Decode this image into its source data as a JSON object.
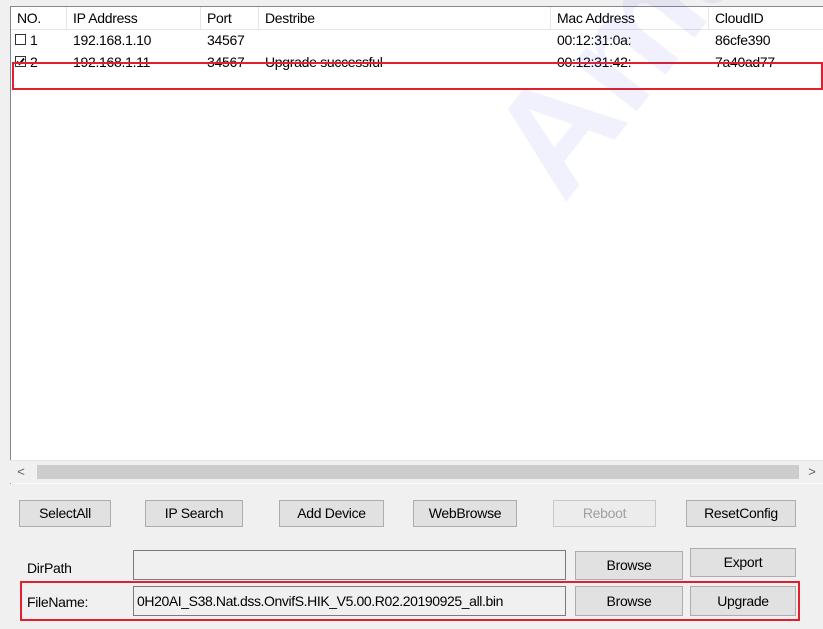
{
  "table": {
    "columns": [
      "NO.",
      "IP Address",
      "Port",
      "Destribe",
      "Mac Address",
      "CloudID"
    ],
    "rows": [
      {
        "no": "1",
        "checked": false,
        "ip": "192.168.1.10",
        "port": "34567",
        "describe": "",
        "mac": "00:12:31:0a:",
        "cloud": "86cfe390"
      },
      {
        "no": "2",
        "checked": true,
        "ip": "192.168.1.11",
        "port": "34567",
        "describe": "Upgrade successful",
        "mac": "00:12:31:42:",
        "cloud": "7a40ad77"
      }
    ]
  },
  "scrollbar": {
    "left_arrow": "<",
    "right_arrow": ">"
  },
  "buttons": {
    "select_all": "SelectAll",
    "ip_search": "IP Search",
    "add_device": "Add Device",
    "web_browse": "WebBrowse",
    "reboot": "Reboot",
    "reset_config": "ResetConfig",
    "browse_dir": "Browse",
    "export": "Export",
    "browse_file": "Browse",
    "upgrade": "Upgrade"
  },
  "form": {
    "dirpath_label": "DirPath",
    "dirpath_value": "",
    "filename_label": "FileName:",
    "filename_value": "0H20AI_S38.Nat.dss.OnvifS.HIK_V5.00.R02.20190925_all.bin"
  },
  "watermark": "Amate",
  "colors": {
    "highlight_border": "#e0202e"
  }
}
